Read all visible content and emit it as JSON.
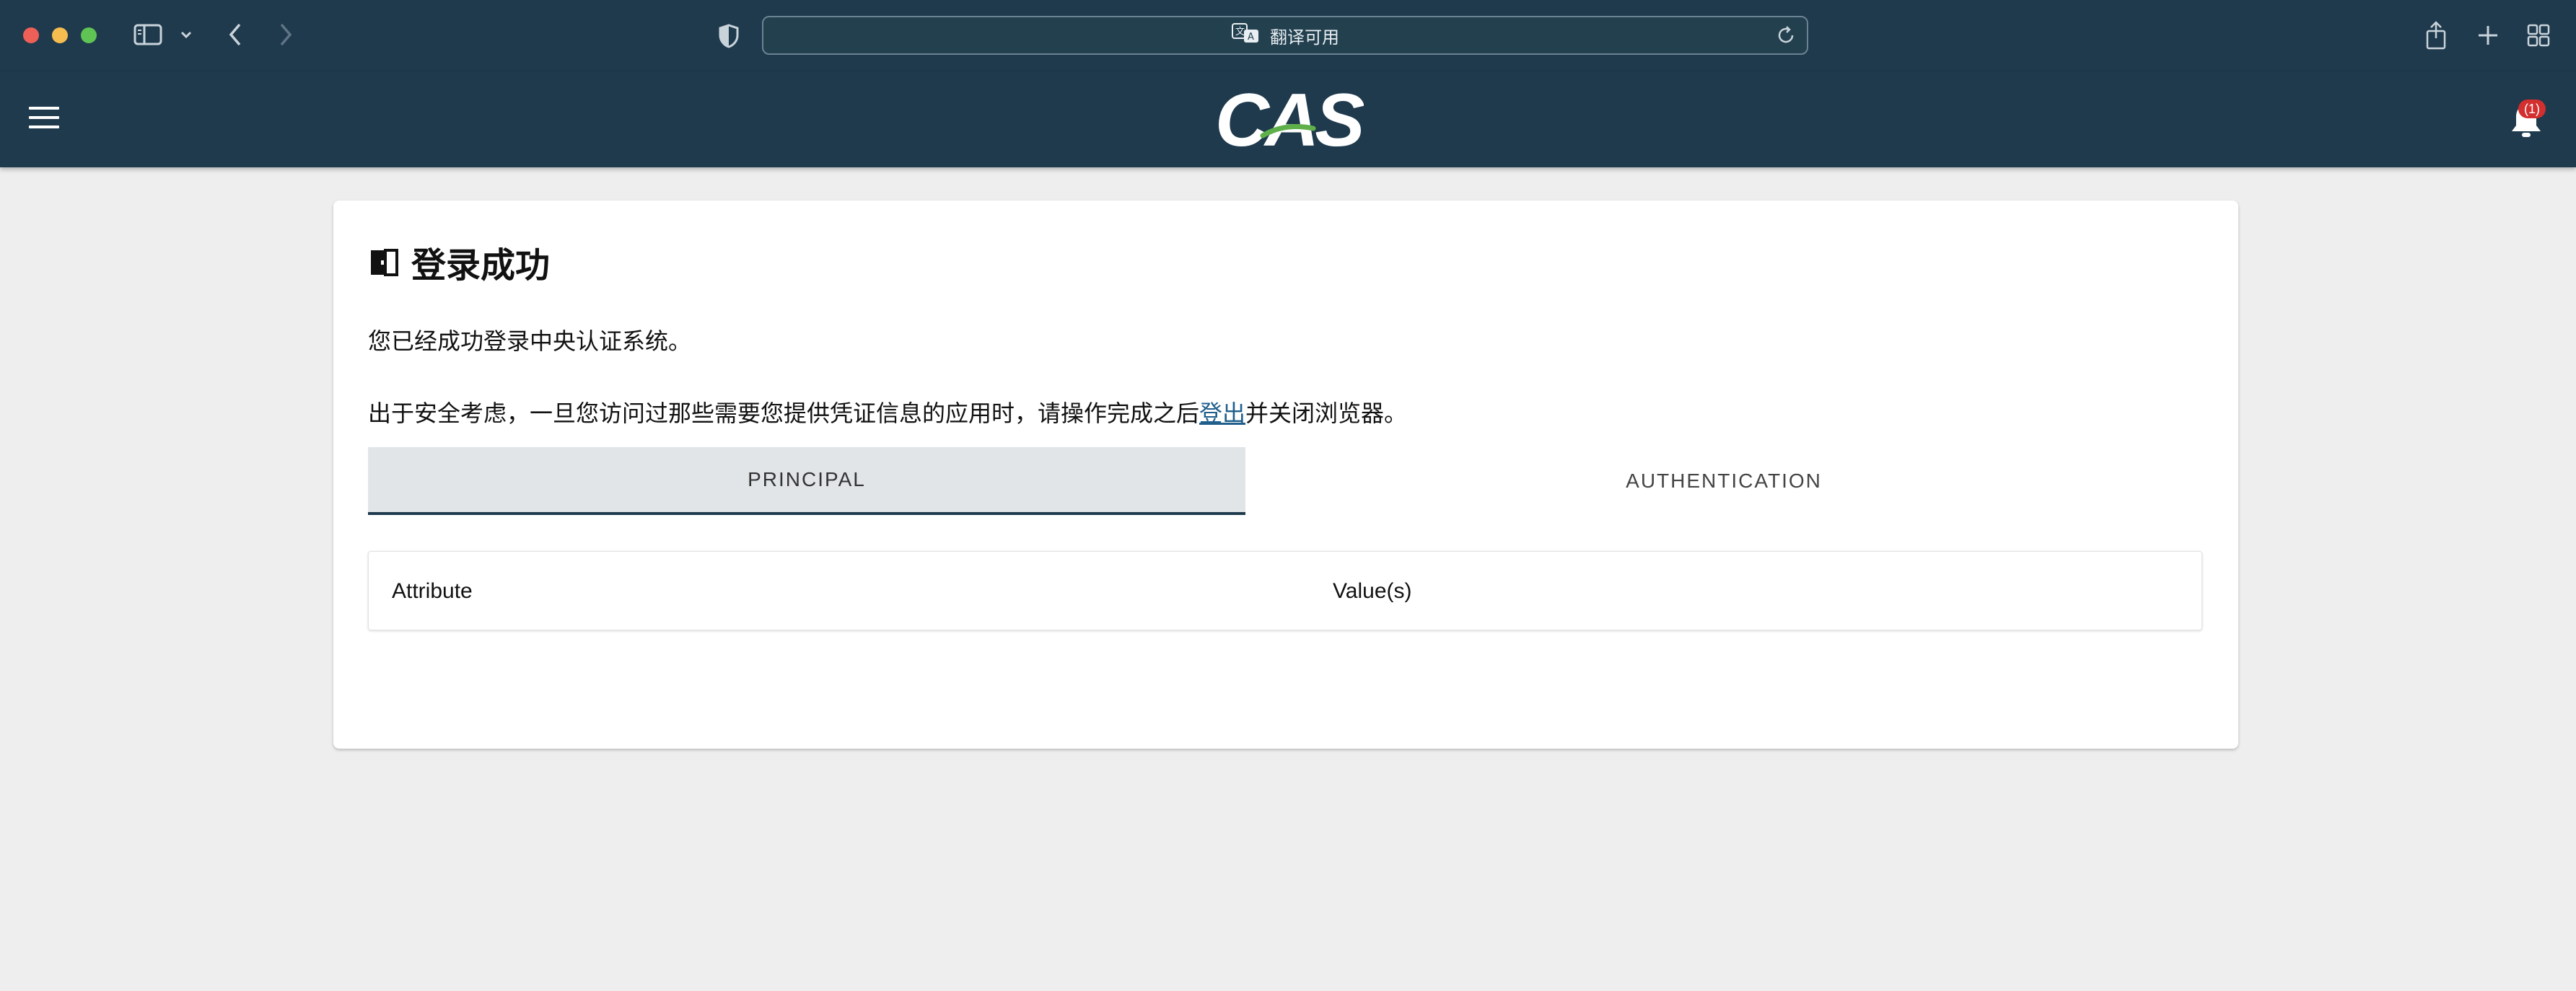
{
  "browser": {
    "address_text": "翻译可用",
    "colors": {
      "chrome_bg": "#1f3a4d",
      "close": "#ee5f57",
      "minimize": "#f5bd4f",
      "zoom": "#5fc454"
    },
    "icons": [
      "sidebar-icon",
      "chevron-down-icon",
      "back-arrow-icon",
      "forward-arrow-icon",
      "shield-icon",
      "translate-icon",
      "reload-icon",
      "share-icon",
      "plus-icon",
      "tabs-grid-icon"
    ]
  },
  "header": {
    "logo_text": "CAS",
    "notification_count": "(1)",
    "icons": [
      "menu-icon",
      "bell-icon"
    ]
  },
  "card": {
    "title": "登录成功",
    "message": "您已经成功登录中央认证系统。",
    "security_before": "出于安全考虑，一旦您访问过那些需要您提供凭证信息的应用时，请操作完成之后",
    "logout_link": "登出",
    "security_after": "并关闭浏览器。",
    "tabs": [
      {
        "label": "PRINCIPAL",
        "active": true
      },
      {
        "label": "AUTHENTICATION",
        "active": false
      }
    ],
    "table": {
      "headers": [
        "Attribute",
        "Value(s)"
      ]
    }
  }
}
